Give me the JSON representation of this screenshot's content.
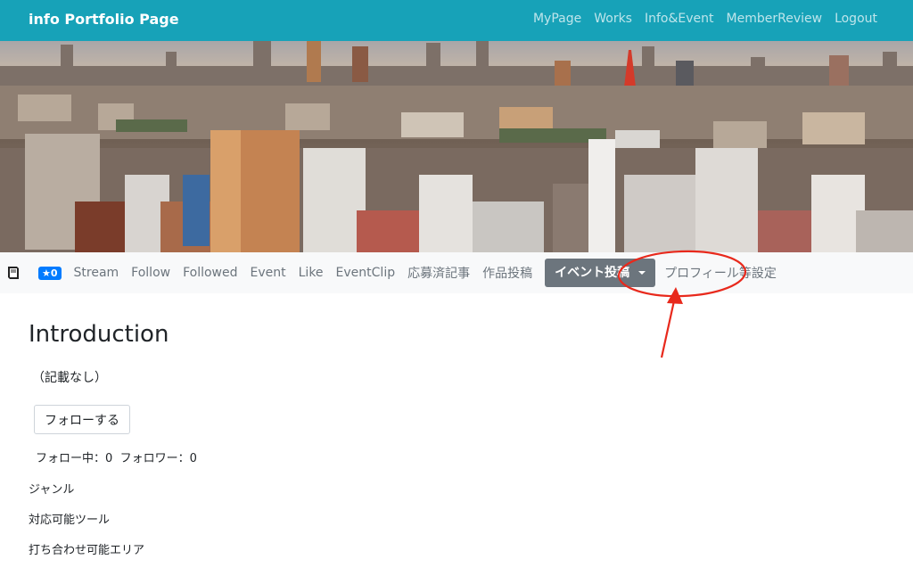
{
  "navbar": {
    "brand": "info Portfolio Page",
    "links": [
      "MyPage",
      "Works",
      "Info&Event",
      "MemberReview",
      "Logout"
    ]
  },
  "subnav": {
    "star_badge": "★0",
    "links": [
      "Stream",
      "Follow",
      "Followed",
      "Event",
      "Like",
      "EventClip",
      "応募済記事",
      "作品投稿"
    ],
    "dropdown_label": "イベント投稿",
    "profile_settings": "プロフィール等設定"
  },
  "main": {
    "title": "Introduction",
    "intro_text": "（記載なし）",
    "follow_button": "フォローする",
    "following_label": "フォロー中：",
    "following_count": "0",
    "followers_label": "フォロワー：",
    "followers_count": "0",
    "genre_label": "ジャンル",
    "tools_label": "対応可能ツール",
    "area_label": "打ち合わせ可能エリア"
  },
  "colors": {
    "navbar_bg": "#17a2b8",
    "badge_bg": "#007bff",
    "dropdown_bg": "#6c757d",
    "annotation_red": "#e8291c"
  },
  "icons": {
    "subnav_leading": "book-icon",
    "dropdown": "caret-down-icon"
  }
}
